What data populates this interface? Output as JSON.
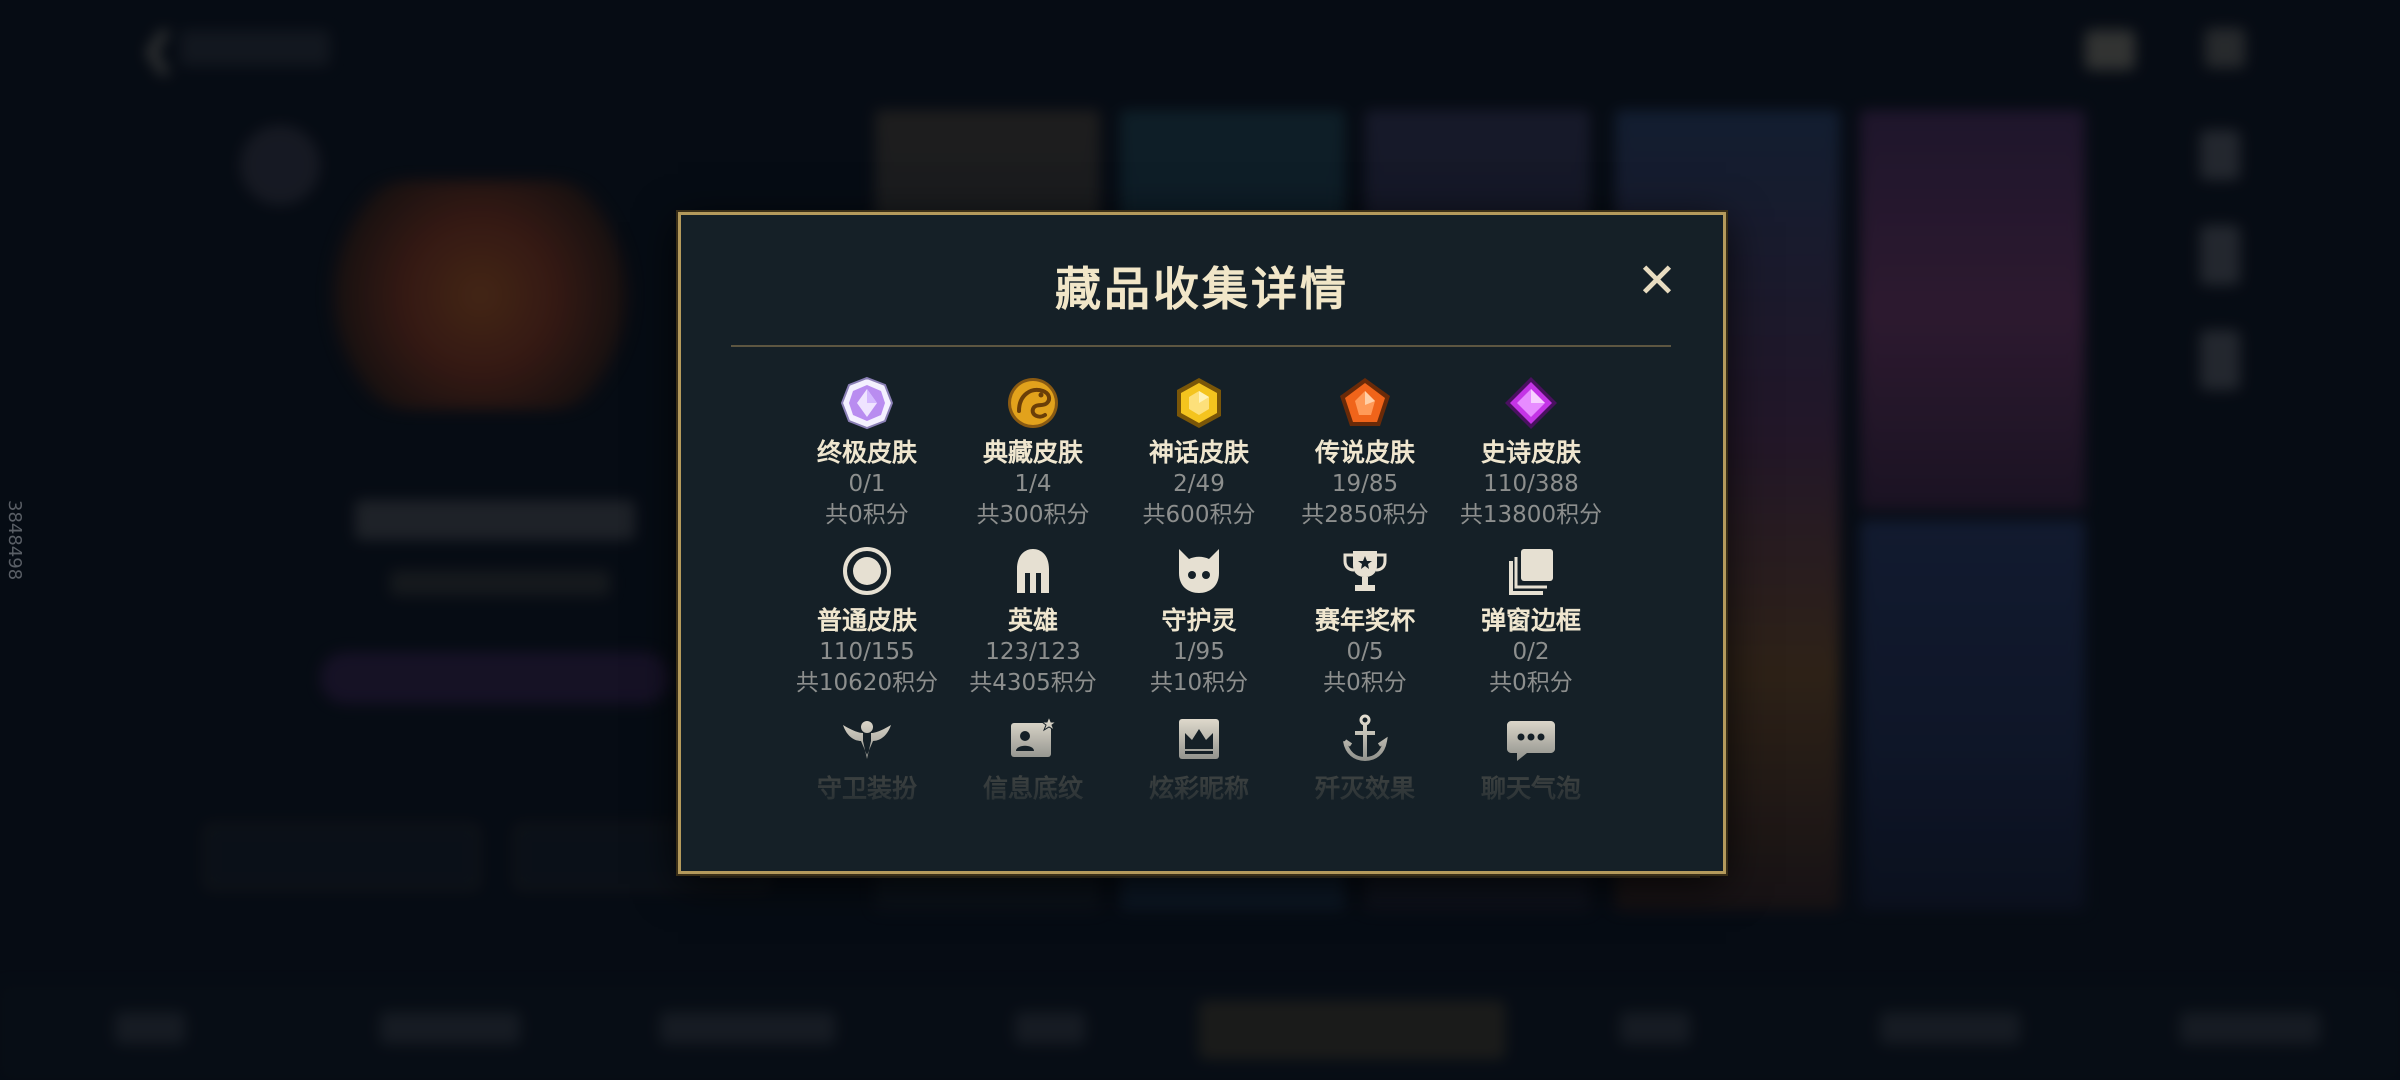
{
  "side_id": "3848498",
  "modal": {
    "title": "藏品收集详情",
    "close_label": "✕"
  },
  "categories_row1": [
    {
      "name": "终极皮肤",
      "count": "0/1",
      "points": "共0积分",
      "icon": "ultimate-gem-icon",
      "color": "#c7a6ff"
    },
    {
      "name": "典藏皮肤",
      "count": "1/4",
      "points": "共300积分",
      "icon": "dragon-medallion-icon",
      "color": "#e6a21a"
    },
    {
      "name": "神话皮肤",
      "count": "2/49",
      "points": "共600积分",
      "icon": "mythic-hexagon-icon",
      "color": "#f1c21c"
    },
    {
      "name": "传说皮肤",
      "count": "19/85",
      "points": "共2850积分",
      "icon": "legend-pentagon-icon",
      "color": "#f06a1a"
    },
    {
      "name": "史诗皮肤",
      "count": "110/388",
      "points": "共13800积分",
      "icon": "epic-diamond-icon",
      "color": "#c238e8"
    }
  ],
  "categories_row2": [
    {
      "name": "普通皮肤",
      "count": "110/155",
      "points": "共10620积分",
      "icon": "ring-icon"
    },
    {
      "name": "英雄",
      "count": "123/123",
      "points": "共4305积分",
      "icon": "helmet-icon"
    },
    {
      "name": "守护灵",
      "count": "1/95",
      "points": "共10积分",
      "icon": "spirit-icon"
    },
    {
      "name": "赛年奖杯",
      "count": "0/5",
      "points": "共0积分",
      "icon": "trophy-icon"
    },
    {
      "name": "弹窗边框",
      "count": "0/2",
      "points": "共0积分",
      "icon": "frame-stack-icon"
    }
  ],
  "categories_row3": [
    {
      "name": "守卫装扮",
      "icon": "guard-wings-icon"
    },
    {
      "name": "信息底纹",
      "icon": "profile-card-icon"
    },
    {
      "name": "炫彩昵称",
      "icon": "crown-banner-icon"
    },
    {
      "name": "歼灭效果",
      "icon": "anchor-icon"
    },
    {
      "name": "聊天气泡",
      "icon": "chat-bubble-icon"
    }
  ]
}
